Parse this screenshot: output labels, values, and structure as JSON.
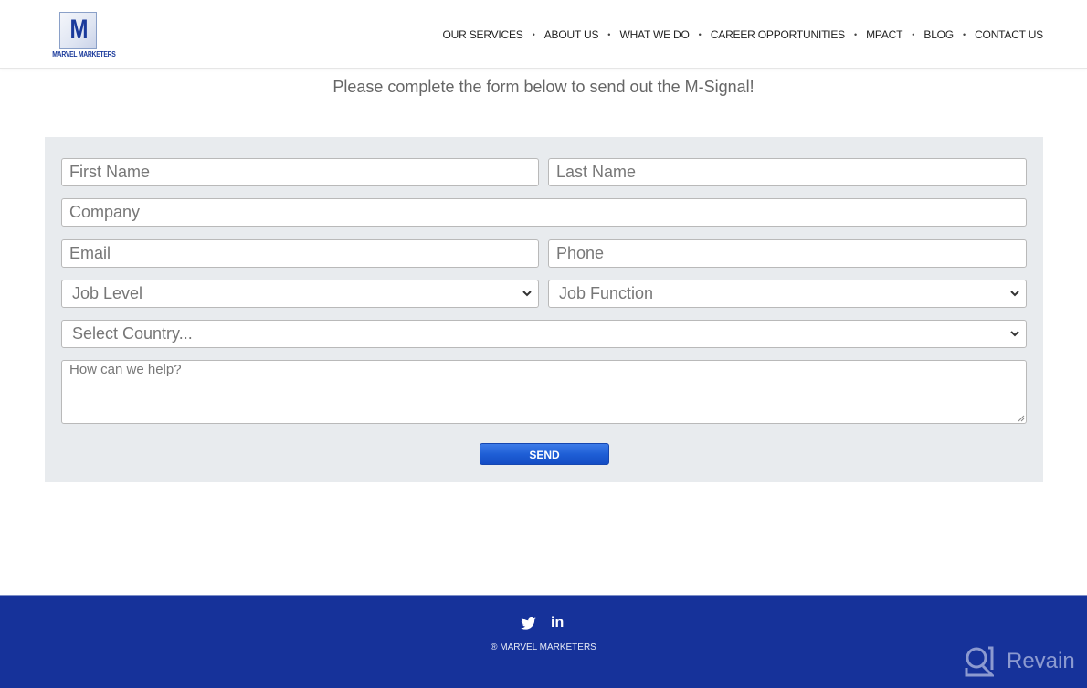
{
  "header": {
    "logo": {
      "initial": "M",
      "text": "MARVEL MARKETERS"
    },
    "nav": [
      {
        "label": "OUR SERVICES"
      },
      {
        "label": "ABOUT US"
      },
      {
        "label": "WHAT WE DO"
      },
      {
        "label": "CAREER OPPORTUNITIES"
      },
      {
        "label": "MPACT"
      },
      {
        "label": "BLOG"
      },
      {
        "label": "CONTACT US"
      }
    ],
    "separator": "•"
  },
  "intro": "Please complete the form below to send out the M-Signal!",
  "form": {
    "first_name": {
      "placeholder": "First Name",
      "value": ""
    },
    "last_name": {
      "placeholder": "Last Name",
      "value": ""
    },
    "company": {
      "placeholder": "Company",
      "value": ""
    },
    "email": {
      "placeholder": "Email",
      "value": ""
    },
    "phone": {
      "placeholder": "Phone",
      "value": ""
    },
    "job_level": {
      "selected": "Job Level"
    },
    "job_function": {
      "selected": "Job Function"
    },
    "country": {
      "selected": "Select Country..."
    },
    "message": {
      "placeholder": "How can we help?",
      "value": ""
    },
    "send_label": "SEND"
  },
  "footer": {
    "social_icons": [
      "twitter-icon",
      "linkedin-icon"
    ],
    "linkedin_glyph": "in",
    "copyright": "® MARVEL MARKETERS",
    "watermark": "Revain"
  },
  "colors": {
    "brand_blue": "#16329a",
    "button_blue": "#1f5fd6",
    "panel_bg": "#e8ebee"
  }
}
